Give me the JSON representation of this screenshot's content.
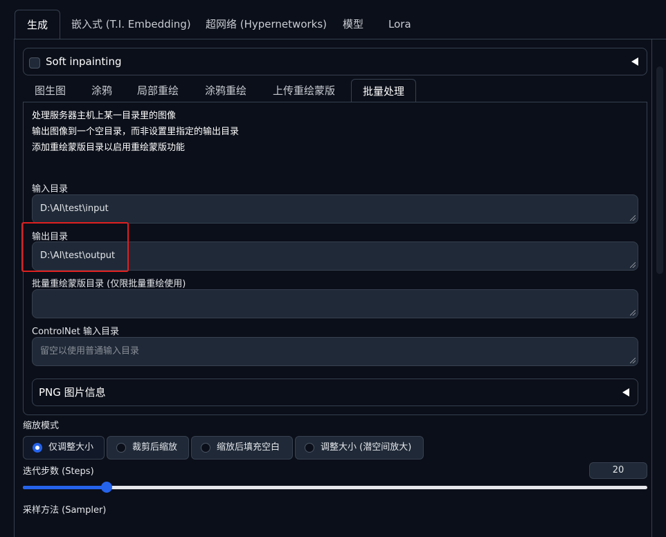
{
  "top_tabs": [
    {
      "label": "生成",
      "active": true
    },
    {
      "label": "嵌入式 (T.I. Embedding)",
      "active": false
    },
    {
      "label": "超网络 (Hypernetworks)",
      "active": false
    },
    {
      "label": "模型",
      "active": false
    },
    {
      "label": "Lora",
      "active": false
    }
  ],
  "soft_inpainting": {
    "label": "Soft inpainting"
  },
  "sub_tabs": [
    {
      "label": "图生图"
    },
    {
      "label": "涂鸦"
    },
    {
      "label": "局部重绘"
    },
    {
      "label": "涂鸦重绘"
    },
    {
      "label": "上传重绘蒙版"
    },
    {
      "label": "批量处理"
    }
  ],
  "batch": {
    "desc": [
      "处理服务器主机上某一目录里的图像",
      "输出图像到一个空目录，而非设置里指定的输出目录",
      "添加重绘蒙版目录以启用重绘蒙版功能"
    ],
    "input_label": "输入目录",
    "input_value": "D:\\AI\\test\\input",
    "output_label": "输出目录",
    "output_value": "D:\\AI\\test\\output",
    "mask_label": "批量重绘蒙版目录 (仅限批量重绘使用)",
    "mask_value": "",
    "controlnet_label": "ControlNet 输入目录",
    "controlnet_placeholder": "留空以使用普通输入目录",
    "png_info_label": "PNG 图片信息"
  },
  "resize_mode": {
    "label": "缩放模式",
    "options": [
      "仅调整大小",
      "裁剪后缩放",
      "缩放后填充空白",
      "调整大小 (潜空间放大)"
    ],
    "selected": "仅调整大小"
  },
  "steps": {
    "label": "迭代步数 (Steps)",
    "value": "20",
    "min": 1,
    "max": 150
  },
  "sampler": {
    "label": "采样方法 (Sampler)"
  }
}
